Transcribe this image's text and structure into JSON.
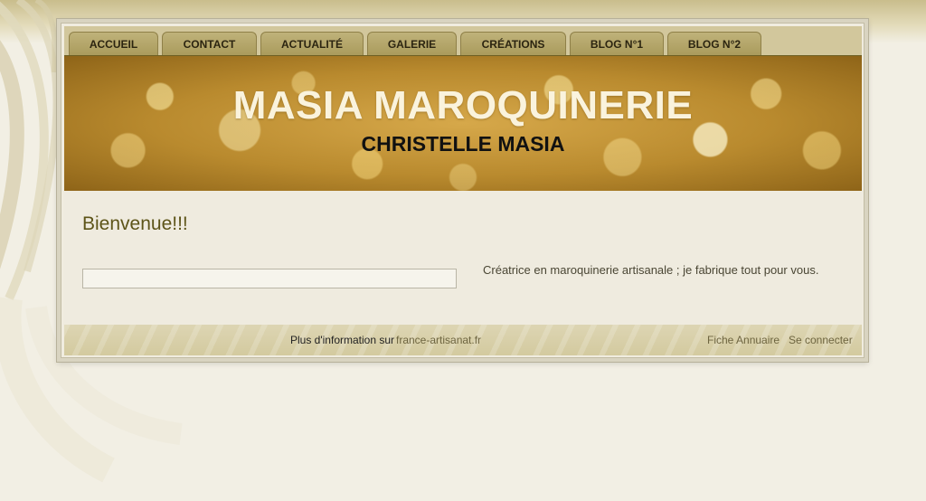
{
  "nav": {
    "items": [
      {
        "label": "ACCUEIL"
      },
      {
        "label": "CONTACT"
      },
      {
        "label": "ACTUALITÉ"
      },
      {
        "label": "GALERIE"
      },
      {
        "label": "CRÉATIONS"
      },
      {
        "label": "BLOG N°1"
      },
      {
        "label": "BLOG N°2"
      }
    ]
  },
  "banner": {
    "title": "MASIA MAROQUINERIE",
    "subtitle": "CHRISTELLE MASIA"
  },
  "main": {
    "heading": "Bienvenue!!!",
    "description": "Créatrice en maroquinerie artisanale ; je fabrique tout pour vous."
  },
  "footer": {
    "info_text": "Plus d'information sur",
    "info_link": "france-artisanat.fr",
    "annuaire_link": "Fiche Annuaire",
    "login_link": "Se connecter"
  },
  "colors": {
    "nav_bar": "#d2c79c",
    "tab": "#b3a466",
    "heading": "#5d5418",
    "banner": "#c4973a"
  }
}
